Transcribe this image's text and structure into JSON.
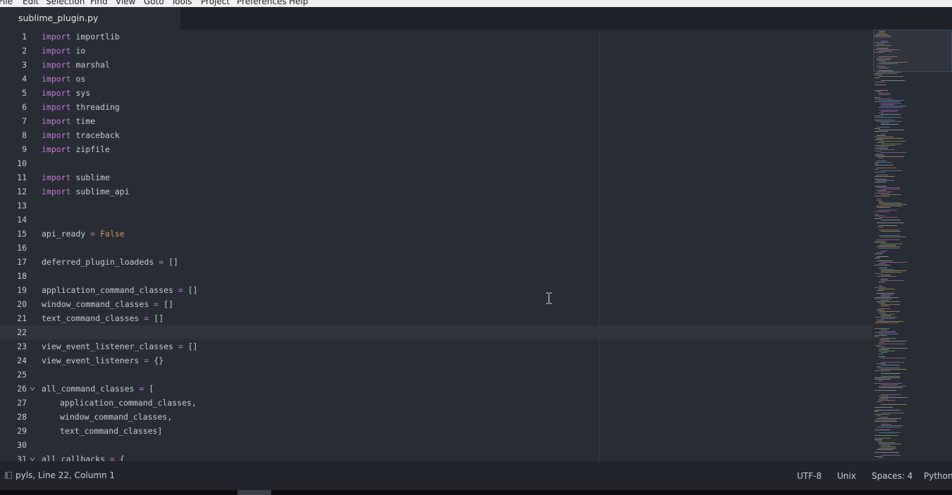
{
  "menu": [
    "File",
    "Edit",
    "Selection",
    "Find",
    "View",
    "Goto",
    "Tools",
    "Project",
    "Preferences",
    "Help"
  ],
  "tab": {
    "title": "sublime_plugin.py"
  },
  "editor": {
    "current_line": 22,
    "lines": [
      {
        "n": "1",
        "tokens": [
          [
            "kw",
            "import"
          ],
          [
            "",
            "importlib"
          ]
        ]
      },
      {
        "n": "2",
        "tokens": [
          [
            "kw",
            "import"
          ],
          [
            "",
            "io"
          ]
        ]
      },
      {
        "n": "3",
        "tokens": [
          [
            "kw",
            "import"
          ],
          [
            "",
            "marshal"
          ]
        ]
      },
      {
        "n": "4",
        "tokens": [
          [
            "kw",
            "import"
          ],
          [
            "",
            "os"
          ]
        ]
      },
      {
        "n": "5",
        "tokens": [
          [
            "kw",
            "import"
          ],
          [
            "",
            "sys"
          ]
        ]
      },
      {
        "n": "6",
        "tokens": [
          [
            "kw",
            "import"
          ],
          [
            "",
            "threading"
          ]
        ]
      },
      {
        "n": "7",
        "tokens": [
          [
            "kw",
            "import"
          ],
          [
            "",
            "time"
          ]
        ]
      },
      {
        "n": "8",
        "tokens": [
          [
            "kw",
            "import"
          ],
          [
            "",
            "traceback"
          ]
        ]
      },
      {
        "n": "9",
        "tokens": [
          [
            "kw",
            "import"
          ],
          [
            "",
            "zipfile"
          ]
        ]
      },
      {
        "n": "10",
        "tokens": []
      },
      {
        "n": "11",
        "tokens": [
          [
            "kw",
            "import"
          ],
          [
            "",
            "sublime"
          ]
        ]
      },
      {
        "n": "12",
        "tokens": [
          [
            "kw",
            "import"
          ],
          [
            "",
            "sublime_api"
          ]
        ]
      },
      {
        "n": "13",
        "tokens": []
      },
      {
        "n": "14",
        "tokens": []
      },
      {
        "n": "15",
        "tokens": [
          [
            "",
            "api_ready"
          ],
          [
            "op",
            "="
          ],
          [
            "const",
            "False"
          ]
        ]
      },
      {
        "n": "16",
        "tokens": []
      },
      {
        "n": "17",
        "tokens": [
          [
            "",
            "deferred_plugin_loadeds"
          ],
          [
            "op",
            "="
          ],
          [
            "",
            "[]"
          ]
        ]
      },
      {
        "n": "18",
        "tokens": []
      },
      {
        "n": "19",
        "tokens": [
          [
            "",
            "application_command_classes"
          ],
          [
            "op",
            "="
          ],
          [
            "",
            "[]"
          ]
        ]
      },
      {
        "n": "20",
        "tokens": [
          [
            "",
            "window_command_classes"
          ],
          [
            "op",
            "="
          ],
          [
            "",
            "[]"
          ]
        ]
      },
      {
        "n": "21",
        "tokens": [
          [
            "",
            "text_command_classes"
          ],
          [
            "op",
            "="
          ],
          [
            "",
            "[]"
          ]
        ]
      },
      {
        "n": "22",
        "tokens": []
      },
      {
        "n": "23",
        "tokens": [
          [
            "",
            "view_event_listener_classes"
          ],
          [
            "op",
            "="
          ],
          [
            "",
            "[]"
          ]
        ]
      },
      {
        "n": "24",
        "tokens": [
          [
            "",
            "view_event_listeners"
          ],
          [
            "op",
            "="
          ],
          [
            "",
            "{}"
          ]
        ]
      },
      {
        "n": "25",
        "tokens": []
      },
      {
        "n": "26",
        "fold": true,
        "tokens": [
          [
            "",
            "all_command_classes"
          ],
          [
            "op",
            "="
          ],
          [
            "",
            "["
          ]
        ]
      },
      {
        "n": "27",
        "indent": true,
        "tokens": [
          [
            "",
            "application_command_classes,"
          ]
        ]
      },
      {
        "n": "28",
        "indent": true,
        "tokens": [
          [
            "",
            "window_command_classes,"
          ]
        ]
      },
      {
        "n": "29",
        "indent": true,
        "tokens": [
          [
            "",
            "text_command_classes]"
          ]
        ]
      },
      {
        "n": "30",
        "tokens": []
      },
      {
        "n": "31",
        "fold": true,
        "tokens": [
          [
            "",
            "all_callbacks"
          ],
          [
            "op",
            "="
          ],
          [
            "",
            "{"
          ]
        ]
      }
    ]
  },
  "status": {
    "left": "pyls, Line 22, Column 1",
    "encoding": "UTF-8",
    "line_endings": "Unix",
    "indentation": "Spaces: 4",
    "syntax": "Python"
  },
  "colors": {
    "keyword": "#c678dd",
    "constant": "#d19a66",
    "text": "#c8ccd4",
    "background": "#282c34"
  }
}
